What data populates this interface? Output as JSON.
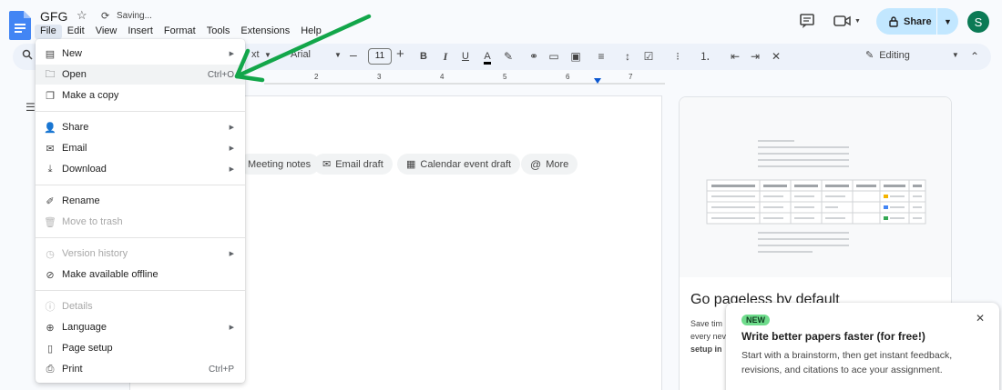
{
  "doc": {
    "title": "GFG",
    "saving": "Saving..."
  },
  "menubar": [
    "File",
    "Edit",
    "View",
    "Insert",
    "Format",
    "Tools",
    "Extensions",
    "Help"
  ],
  "share": {
    "label": "Share"
  },
  "avatar": {
    "initial": "S",
    "color": "#0b7a55"
  },
  "toolbar": {
    "style_partial": "xt",
    "font": "Arial",
    "font_size": "11",
    "editing": "Editing"
  },
  "ruler": [
    "2",
    "3",
    "4",
    "5",
    "6",
    "7"
  ],
  "chips": [
    "Meeting notes",
    "Email draft",
    "Calendar event draft",
    "More"
  ],
  "side_panel": {
    "heading": "Go pageless by default",
    "text_lines": [
      "Save tim",
      "every nev",
      "setup in"
    ]
  },
  "popup": {
    "badge": "NEW",
    "title": "Write better papers faster (for free!)",
    "body": "Start with a brainstorm, then get instant feedback, revisions, and citations to ace your assignment."
  },
  "file_menu": {
    "items": [
      {
        "label": "New",
        "icon": "new-doc-icon",
        "arrow": true
      },
      {
        "label": "Open",
        "icon": "folder-icon",
        "shortcut": "Ctrl+O"
      },
      {
        "label": "Make a copy",
        "icon": "copy-icon"
      },
      {
        "label": "Share",
        "icon": "person-add-icon",
        "arrow": true
      },
      {
        "label": "Email",
        "icon": "email-icon",
        "arrow": true
      },
      {
        "label": "Download",
        "icon": "download-icon",
        "arrow": true
      },
      {
        "label": "Rename",
        "icon": "rename-icon"
      },
      {
        "label": "Move to trash",
        "icon": "trash-icon",
        "disabled": true
      },
      {
        "label": "Version history",
        "icon": "history-icon",
        "arrow": true,
        "disabled": true
      },
      {
        "label": "Make available offline",
        "icon": "offline-icon"
      },
      {
        "label": "Details",
        "icon": "info-icon",
        "disabled": true
      },
      {
        "label": "Language",
        "icon": "globe-icon",
        "arrow": true
      },
      {
        "label": "Page setup",
        "icon": "page-icon"
      },
      {
        "label": "Print",
        "icon": "print-icon",
        "shortcut": "Ctrl+P"
      }
    ]
  },
  "colors": {
    "accent": "#0b57d0",
    "share_bg": "#c2e7ff",
    "arrow": "#12a64a"
  }
}
